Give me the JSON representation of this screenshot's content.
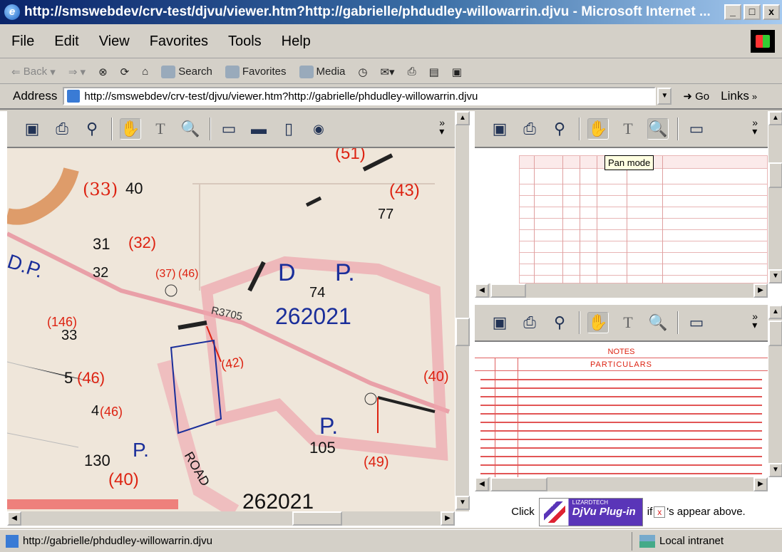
{
  "window": {
    "title": "http://smswebdev/crv-test/djvu/viewer.htm?http://gabrielle/phdudley-willowarrin.djvu - Microsoft Internet ...",
    "controls": [
      "_",
      "□",
      "x"
    ]
  },
  "menu": {
    "items": [
      {
        "label": "File"
      },
      {
        "label": "Edit"
      },
      {
        "label": "View"
      },
      {
        "label": "Favorites"
      },
      {
        "label": "Tools"
      },
      {
        "label": "Help"
      }
    ]
  },
  "toolbar": {
    "back": "Back",
    "search": "Search",
    "favorites": "Favorites",
    "media": "Media"
  },
  "address": {
    "label": "Address",
    "value": "http://smswebdev/crv-test/djvu/viewer.htm?http://gabrielle/phdudley-willowarrin.djvu",
    "go": "Go",
    "links": "Links"
  },
  "tooltip": "Pan mode",
  "map_labels": [
    {
      "text": "(33)",
      "color": "#d21"
    },
    {
      "text": "40",
      "color": "#111"
    },
    {
      "text": "31",
      "color": "#111"
    },
    {
      "text": "(32)",
      "color": "#d21"
    },
    {
      "text": "32",
      "color": "#111"
    },
    {
      "text": "(37)",
      "color": "#d21"
    },
    {
      "text": "(46)",
      "color": "#d21"
    },
    {
      "text": "(43)",
      "color": "#d21"
    },
    {
      "text": "77",
      "color": "#111"
    },
    {
      "text": "D",
      "color": "#1a2e9a"
    },
    {
      "text": "P.",
      "color": "#1a2e9a"
    },
    {
      "text": "74",
      "color": "#111"
    },
    {
      "text": "262021",
      "color": "#1a2e9a"
    },
    {
      "text": "R3705",
      "color": "#333"
    },
    {
      "text": "(146)",
      "color": "#d21"
    },
    {
      "text": "33",
      "color": "#111"
    },
    {
      "text": "5",
      "color": "#111"
    },
    {
      "text": "(46)",
      "color": "#d21"
    },
    {
      "text": "4",
      "color": "#111"
    },
    {
      "text": "(46)",
      "color": "#d21"
    },
    {
      "text": "130",
      "color": "#111"
    },
    {
      "text": "P.",
      "color": "#1a2e9a"
    },
    {
      "text": "(40)",
      "color": "#d21"
    },
    {
      "text": "P.",
      "color": "#1a2e9a"
    },
    {
      "text": "105",
      "color": "#111"
    },
    {
      "text": "(49)",
      "color": "#d21"
    },
    {
      "text": "(40)",
      "color": "#d21"
    },
    {
      "text": "(42)",
      "color": "#d21"
    },
    {
      "text": "ROAD",
      "color": "#111"
    },
    {
      "text": "(51)",
      "color": "#d21"
    },
    {
      "text": "D.P.",
      "color": "#1a2e9a"
    },
    {
      "text": "262021",
      "color": "#111"
    }
  ],
  "notes": {
    "header": "NOTES",
    "subheader": "PARTICULARS"
  },
  "plugin": {
    "click": "Click",
    "brand_small": "LIZARDTECH",
    "brand": "DjVu Plug-in",
    "if": "if",
    "x": "x",
    "appear": "'s appear above."
  },
  "status": {
    "url": "http://gabrielle/phdudley-willowarrin.djvu",
    "zone": "Local intranet"
  }
}
